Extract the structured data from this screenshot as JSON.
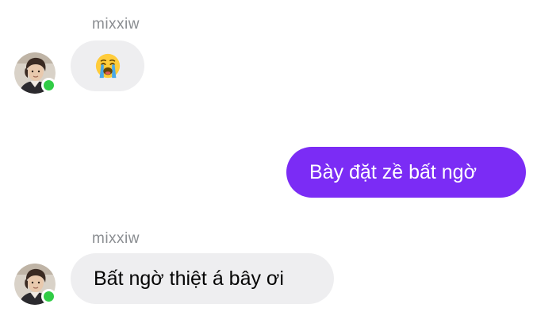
{
  "messages": [
    {
      "sender": "mixxiw",
      "direction": "incoming",
      "content_icon": "loudly-crying-face-emoji",
      "text": "",
      "sender_online": true
    },
    {
      "direction": "outgoing",
      "text": "Bày đặt zề bất ngờ"
    },
    {
      "sender": "mixxiw",
      "direction": "incoming",
      "text": "Bất ngờ thiệt á bây ơi",
      "sender_online": true
    }
  ],
  "colors": {
    "outgoing_bubble": "#7b2cf5",
    "incoming_bubble": "#eeeef0",
    "online_indicator": "#31cc46",
    "sender_name": "#8a8d91"
  }
}
